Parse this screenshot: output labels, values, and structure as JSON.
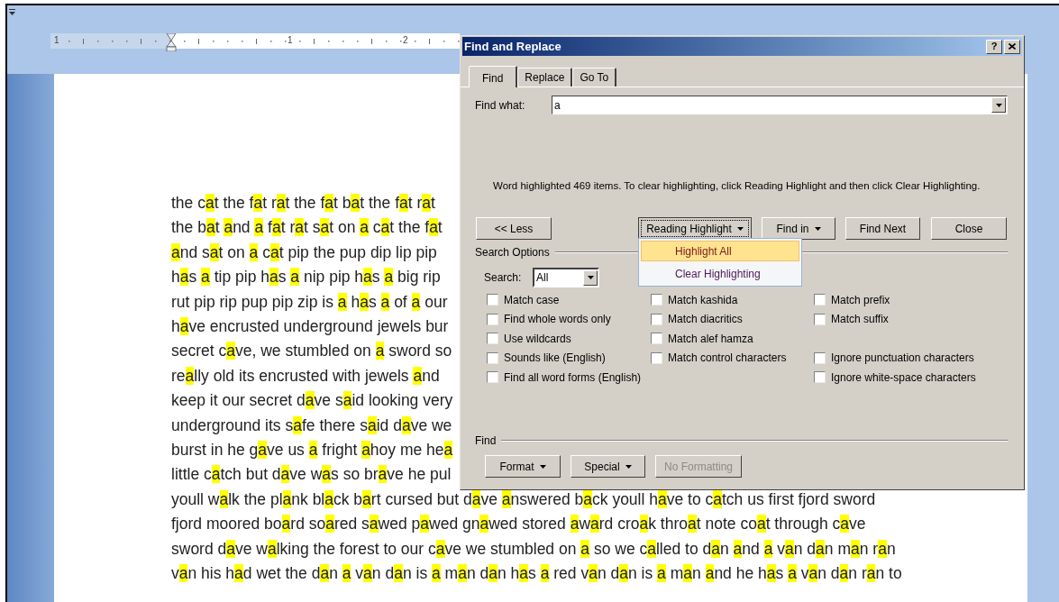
{
  "ruler": {
    "labels": [
      "1",
      "1",
      "2"
    ]
  },
  "document": {
    "lines": [
      "the cat the fat rat the fat bat the fat rat",
      "the bat and a fat rat sat on a cat the fat",
      "and sat on a cat pip the pup dip lip pip",
      "has a tip pip has a nip pip has a big rip",
      "rut pip rip pup pip zip is a has a of a our",
      "have encrusted underground jewels bur",
      "secret cave, we stumbled on a sword so",
      "really old its encrusted with jewels and",
      "keep it our secret dave said looking very",
      "underground its safe there said dave we",
      "burst in he gave us a fright ahoy me hea",
      "little catch but dave was so brave he pul",
      "youll walk the plank black bart cursed but dave answered back youll have to catch us first fjord sword",
      "fjord moored board soared sawed pawed gnawed stored award croak throat note coat through cave",
      "sword dave walking the forest to our cave we stumbled on a so we called to dan and a van dan man ran",
      "van his had wet the dan a van dan is a man dan has a red van dan is a man and he has a van dan ran to"
    ]
  },
  "dialog": {
    "title": "Find and Replace",
    "help": "?",
    "tabs": [
      {
        "label": "Find",
        "selected": true
      },
      {
        "label": "Replace",
        "selected": false
      },
      {
        "label": "Go To",
        "selected": false
      }
    ],
    "find_what": {
      "label": "Find what:",
      "value": "a"
    },
    "message": "Word highlighted 469 items. To clear highlighting, click Reading Highlight and then click Clear Highlighting.",
    "buttons": [
      {
        "label": "<< Less",
        "kind": "plain"
      },
      {
        "label": "Reading Highlight",
        "kind": "menu",
        "expanded": true
      },
      {
        "label": "Find in",
        "kind": "menu",
        "expanded": false
      },
      {
        "label": "Find Next",
        "kind": "plain"
      },
      {
        "label": "Close",
        "kind": "plain"
      }
    ],
    "menu": [
      {
        "label": "Highlight All",
        "selected": true
      },
      {
        "label": "Clear Highlighting",
        "selected": false
      }
    ],
    "search_options": {
      "title": "Search Options",
      "search_label": "Search:",
      "search_value": "All",
      "rows": [
        [
          {
            "label": "Match case",
            "checked": false
          },
          {
            "label": "Match kashida",
            "checked": false
          },
          {
            "label": "Match prefix",
            "checked": false
          }
        ],
        [
          {
            "label": "Find whole words only",
            "checked": false
          },
          {
            "label": "Match diacritics",
            "checked": false
          },
          {
            "label": "Match suffix",
            "checked": false
          }
        ],
        [
          {
            "label": "Use wildcards",
            "checked": false
          },
          {
            "label": "Match alef hamza",
            "checked": false
          },
          null
        ],
        [
          {
            "label": "Sounds like (English)",
            "checked": false
          },
          {
            "label": "Match control characters",
            "checked": false
          },
          {
            "label": "Ignore punctuation characters",
            "checked": false
          }
        ],
        [
          {
            "label": "Find all word forms (English)",
            "checked": false
          },
          null,
          {
            "label": "Ignore white-space characters",
            "checked": false
          }
        ]
      ]
    },
    "find_section": {
      "title": "Find",
      "buttons": [
        {
          "label": "Format",
          "kind": "menu",
          "disabled": false
        },
        {
          "label": "Special",
          "kind": "menu",
          "disabled": false
        },
        {
          "label": "No Formatting",
          "kind": "plain",
          "disabled": true
        }
      ]
    }
  }
}
